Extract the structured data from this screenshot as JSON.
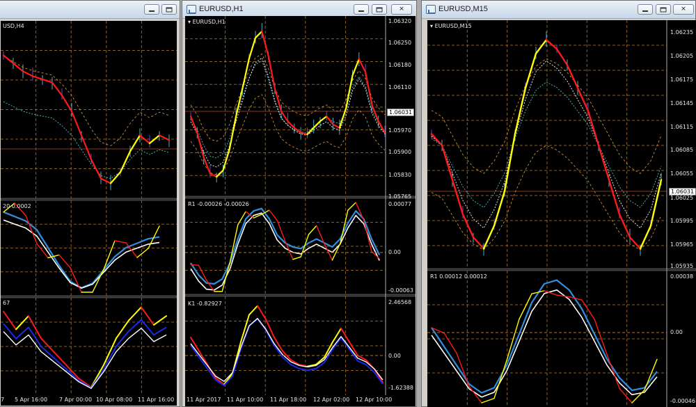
{
  "windows": [
    {
      "title": "",
      "chart_title": "USD,H4",
      "panel2_label": "20 0.0002",
      "panel3_label": "67",
      "price_labels": [],
      "ind1_labels": [],
      "ind2_labels": [],
      "price_tag": "",
      "time_labels": [
        "7",
        "5 Apr 16:00",
        "7 Apr 00:00",
        "10 Apr 08:00",
        "11 Apr 16:00"
      ]
    },
    {
      "title": "EURUSD,H1",
      "chart_title": "EURUSD,H1",
      "panel2_label": "R1 -0.00026 -0.00026",
      "panel3_label": "K1 -0.82927",
      "price_labels": [
        "1.06320",
        "1.06250",
        "1.06180",
        "1.06110",
        "1.05970",
        "1.05900",
        "1.05830",
        "1.05765"
      ],
      "ind1_labels": [
        "0.00077",
        "0.00",
        "-0.00063"
      ],
      "ind2_labels": [
        "2.46568",
        "0.00",
        "-1.62388"
      ],
      "price_tag": "1.06031",
      "time_labels": [
        "11 Apr 2017",
        "11 Apr 10:00",
        "11 Apr 18:00",
        "12 Apr 02:00",
        "12 Apr 10:00"
      ]
    },
    {
      "title": "EURUSD,M15",
      "chart_title": "EURUSD,M15",
      "panel2_label": "R1 0.00012 0.00012",
      "panel3_label": "",
      "price_labels": [
        "1.06235",
        "1.06205",
        "1.06175",
        "1.06145",
        "1.06115",
        "1.06085",
        "1.06055",
        "1.06025",
        "1.05995",
        "1.05965",
        "1.05935"
      ],
      "ind1_labels": [
        "0.00038",
        "0.00",
        "-0.00046"
      ],
      "ind2_labels": [],
      "price_tag": "1.06031",
      "time_labels": []
    }
  ],
  "colors": {
    "grid": "#b07a2a",
    "price_line": "#8a3a20",
    "bull": "#ffff00",
    "bear": "#ff1a1a",
    "ma_blue": "#2f8fe0",
    "ma_white": "#ffffff",
    "k_blue": "#1b28e6",
    "candle_cyan": "#4fb0c8",
    "candle_violet": "#7a3fd0"
  },
  "icons": {
    "min": "minimize-icon",
    "max": "maximize-icon",
    "close": "close-icon",
    "window": "chart-window-icon"
  }
}
